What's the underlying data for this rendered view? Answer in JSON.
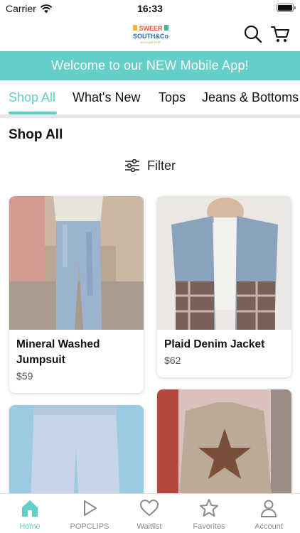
{
  "status_bar": {
    "carrier": "Carrier",
    "time": "16:33"
  },
  "header": {
    "logo_text_top": "SWEER",
    "logo_text_bottom": "SOUTH&Co",
    "logo_tagline": "BOUTIQUE PREP"
  },
  "banner": {
    "text": "Welcome to our NEW Mobile App!"
  },
  "tabs": [
    {
      "label": "Shop All",
      "active": true
    },
    {
      "label": "What's New",
      "active": false
    },
    {
      "label": "Tops",
      "active": false
    },
    {
      "label": "Jeans & Bottoms",
      "active": false
    }
  ],
  "section": {
    "title": "Shop All",
    "filter_label": "Filter"
  },
  "products": [
    {
      "name": "Mineral Washed Jumpsuit",
      "price": "$59"
    },
    {
      "name": "Plaid Denim Jacket",
      "price": "$62"
    },
    {
      "name": "",
      "price": ""
    },
    {
      "name": "",
      "price": ""
    }
  ],
  "bottom_nav": [
    {
      "label": "Home",
      "icon": "home-icon",
      "active": true
    },
    {
      "label": "POPCLIPS",
      "icon": "play-icon",
      "active": false
    },
    {
      "label": "Waitlist",
      "icon": "heart-icon",
      "active": false
    },
    {
      "label": "Favorites",
      "icon": "star-icon",
      "active": false
    },
    {
      "label": "Account",
      "icon": "person-icon",
      "active": false
    }
  ],
  "colors": {
    "accent": "#62cfc9",
    "text": "#111111",
    "muted": "#8a8a8a"
  }
}
